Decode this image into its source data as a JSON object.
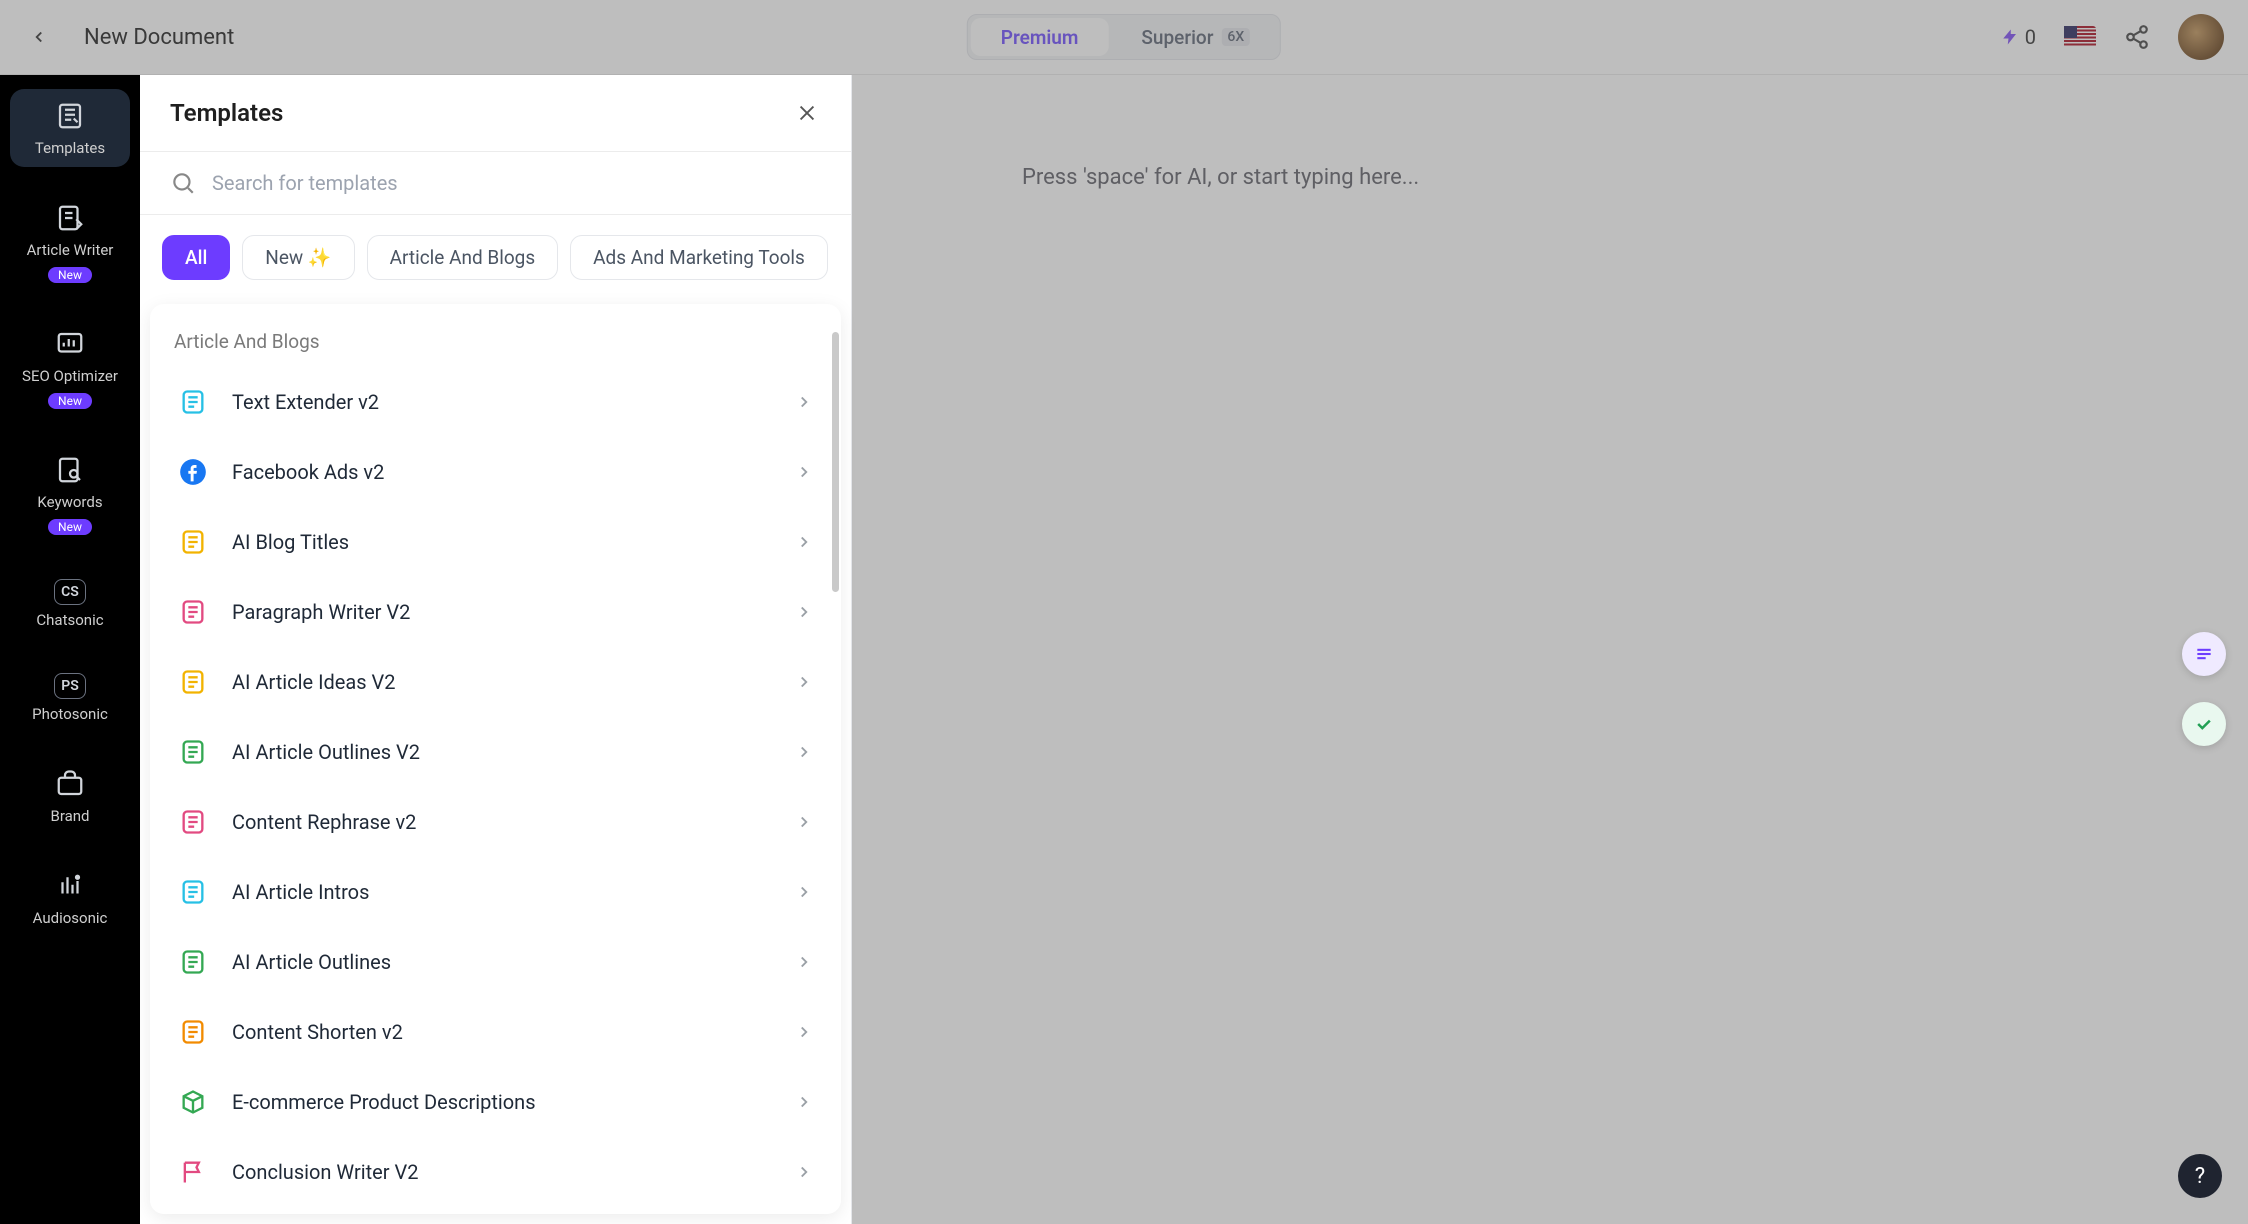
{
  "header": {
    "doc_title": "New Document",
    "plan": {
      "premium": "Premium",
      "superior": "Superior",
      "superior_badge": "6X"
    },
    "credits": "0"
  },
  "rail": {
    "items": [
      {
        "label": "Templates",
        "icon": "templates-icon",
        "badge": null,
        "active": true
      },
      {
        "label": "Article Writer",
        "icon": "article-writer-icon",
        "badge": "New",
        "active": false
      },
      {
        "label": "SEO Optimizer",
        "icon": "seo-optimizer-icon",
        "badge": "New",
        "active": false
      },
      {
        "label": "Keywords",
        "icon": "keywords-icon",
        "badge": "New",
        "active": false
      },
      {
        "label": "Chatsonic",
        "icon": "chatsonic-icon",
        "badge": null,
        "active": false,
        "mono": "CS"
      },
      {
        "label": "Photosonic",
        "icon": "photosonic-icon",
        "badge": null,
        "active": false,
        "mono": "PS"
      },
      {
        "label": "Brand",
        "icon": "brand-icon",
        "badge": null,
        "active": false
      },
      {
        "label": "Audiosonic",
        "icon": "audiosonic-icon",
        "badge": null,
        "active": false
      }
    ]
  },
  "panel": {
    "title": "Templates",
    "search_placeholder": "Search for templates",
    "chips": [
      "All",
      "New ✨",
      "Article And Blogs",
      "Ads And Marketing Tools"
    ],
    "active_chip": 0,
    "group_label": "Article And Blogs",
    "templates": [
      {
        "name": "Text Extender v2",
        "color": "#27c0e5"
      },
      {
        "name": "Facebook Ads v2",
        "color": "#1877f2"
      },
      {
        "name": "AI Blog Titles",
        "color": "#f2b300"
      },
      {
        "name": "Paragraph Writer V2",
        "color": "#e24a81"
      },
      {
        "name": "AI Article Ideas V2",
        "color": "#f2b300"
      },
      {
        "name": "AI Article Outlines V2",
        "color": "#34a853"
      },
      {
        "name": "Content Rephrase v2",
        "color": "#e24a81"
      },
      {
        "name": "AI Article Intros",
        "color": "#27c0e5"
      },
      {
        "name": "AI Article Outlines",
        "color": "#34a853"
      },
      {
        "name": "Content Shorten v2",
        "color": "#f28b00"
      },
      {
        "name": "E-commerce Product Descriptions",
        "color": "#34a853"
      },
      {
        "name": "Conclusion Writer V2",
        "color": "#e24a81"
      }
    ]
  },
  "editor": {
    "placeholder": "Press 'space' for AI, or start typing here..."
  }
}
